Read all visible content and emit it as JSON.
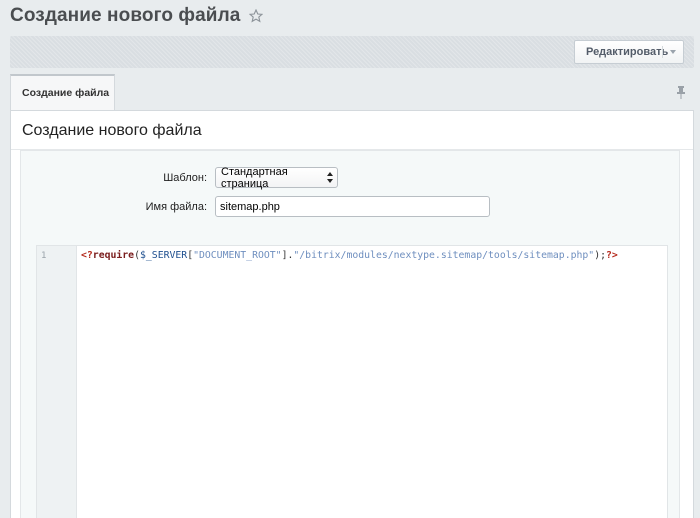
{
  "page": {
    "title": "Создание нового файла"
  },
  "toolbar": {
    "edit_label": "Редактировать"
  },
  "tabs": [
    {
      "label": "Создание файла",
      "active": true
    }
  ],
  "panel": {
    "title": "Создание нового файла"
  },
  "form": {
    "template_label": "Шаблон:",
    "template_value": "Стандартная страница",
    "filename_label": "Имя файла:",
    "filename_value": "sitemap.php"
  },
  "editor": {
    "line_number": "1",
    "tokens": [
      {
        "cls": "tk-tag",
        "text": "<?"
      },
      {
        "cls": "tk-kw",
        "text": "require"
      },
      {
        "cls": "tk-punc",
        "text": "("
      },
      {
        "cls": "tk-var",
        "text": "$_SERVER"
      },
      {
        "cls": "tk-punc",
        "text": "["
      },
      {
        "cls": "tk-str",
        "text": "\"DOCUMENT_ROOT\""
      },
      {
        "cls": "tk-punc",
        "text": "]."
      },
      {
        "cls": "tk-str",
        "text": "\"/bitrix/modules/nextype.sitemap/tools/sitemap.php\""
      },
      {
        "cls": "tk-punc",
        "text": ");"
      },
      {
        "cls": "tk-tag",
        "text": "?>"
      }
    ]
  },
  "icons": {
    "star": "star-outline-icon",
    "caret": "chevron-down-icon",
    "pin": "pin-icon",
    "select": "select-arrows-icon"
  },
  "colors": {
    "background": "#e8ecee",
    "title": "#4a4d50",
    "php_tag": "#b52a1d",
    "string": "#6f8fbf"
  }
}
